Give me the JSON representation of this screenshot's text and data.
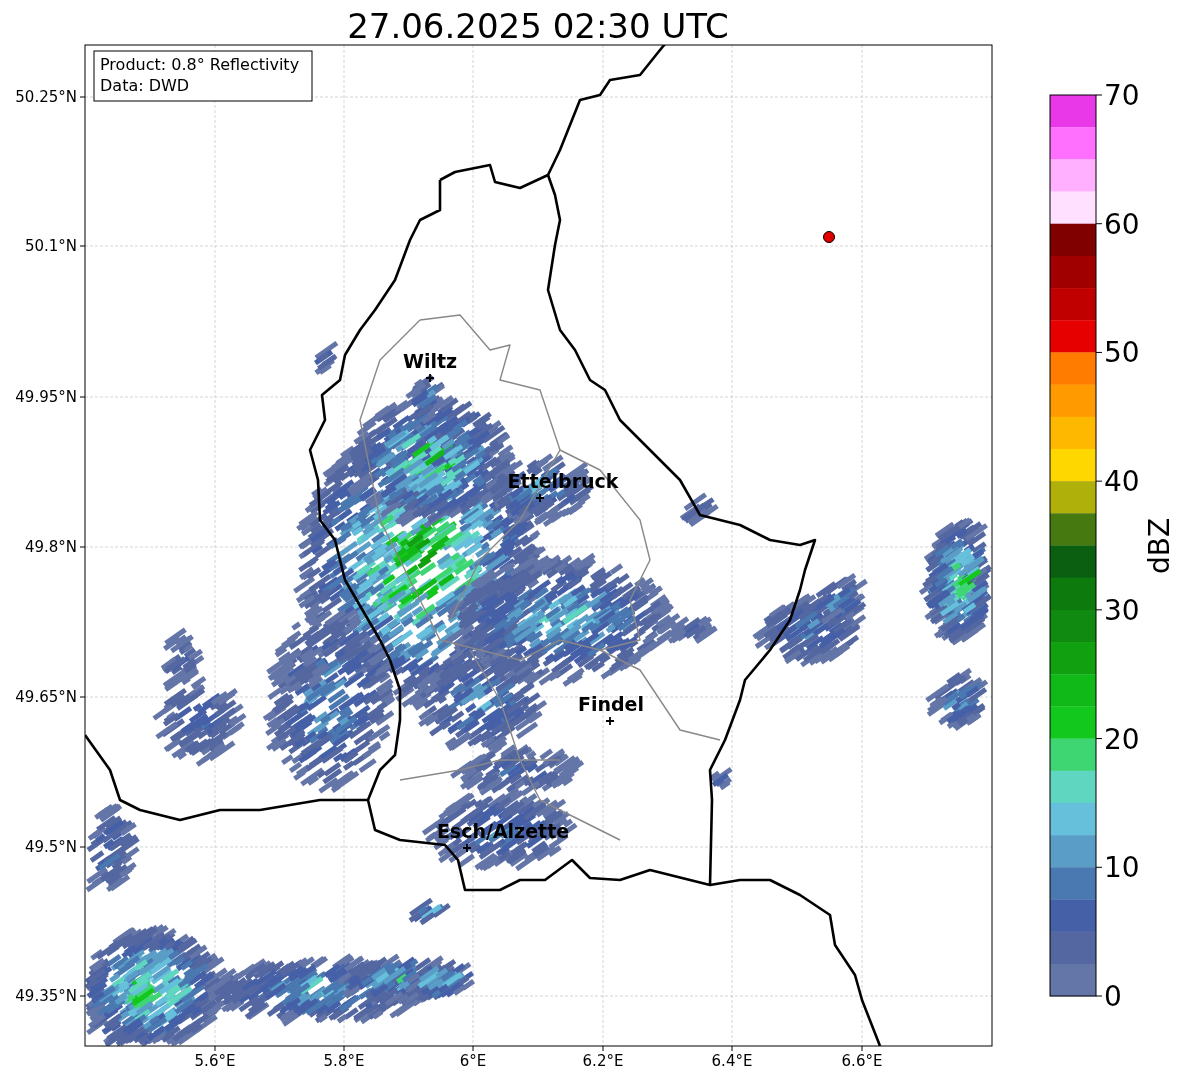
{
  "title": "27.06.2025 02:30 UTC",
  "info_box": [
    "Product: 0.8° Reflectivity",
    "Data: DWD"
  ],
  "map": {
    "xticks": [
      "5.6°E",
      "5.8°E",
      "6°E",
      "6.2°E",
      "6.4°E",
      "6.6°E"
    ],
    "yticks": [
      "50.25°N",
      "50.1°N",
      "49.95°N",
      "49.8°N",
      "49.65°N",
      "49.5°N",
      "49.35°N"
    ],
    "places": [
      {
        "name": "Wiltz"
      },
      {
        "name": "Ettelbruck"
      },
      {
        "name": "Findel"
      },
      {
        "name": "Esch/Alzette"
      }
    ]
  },
  "colorbar": {
    "label": "dBZ",
    "ticks": [
      "70",
      "60",
      "50",
      "40",
      "30",
      "20",
      "10",
      "0"
    ],
    "steps": [
      {
        "color": "#e838e8"
      },
      {
        "color": "#ff70ff"
      },
      {
        "color": "#ffb0ff"
      },
      {
        "color": "#ffe0ff"
      },
      {
        "color": "#800000"
      },
      {
        "color": "#a00000"
      },
      {
        "color": "#c00000"
      },
      {
        "color": "#e60000"
      },
      {
        "color": "#ff7c00"
      },
      {
        "color": "#ff9a00"
      },
      {
        "color": "#ffb800"
      },
      {
        "color": "#ffd700"
      },
      {
        "color": "#b0b00a"
      },
      {
        "color": "#467a10"
      },
      {
        "color": "#0a6010"
      },
      {
        "color": "#0c7a0c"
      },
      {
        "color": "#108a10"
      },
      {
        "color": "#10a010"
      },
      {
        "color": "#10b818"
      },
      {
        "color": "#12c81c"
      },
      {
        "color": "#3ed673"
      },
      {
        "color": "#5fd6c0"
      },
      {
        "color": "#66c0dc"
      },
      {
        "color": "#5a9ec8"
      },
      {
        "color": "#4a78b0"
      },
      {
        "color": "#4660a8"
      },
      {
        "color": "#5467a0"
      },
      {
        "color": "#6475a8"
      }
    ]
  }
}
